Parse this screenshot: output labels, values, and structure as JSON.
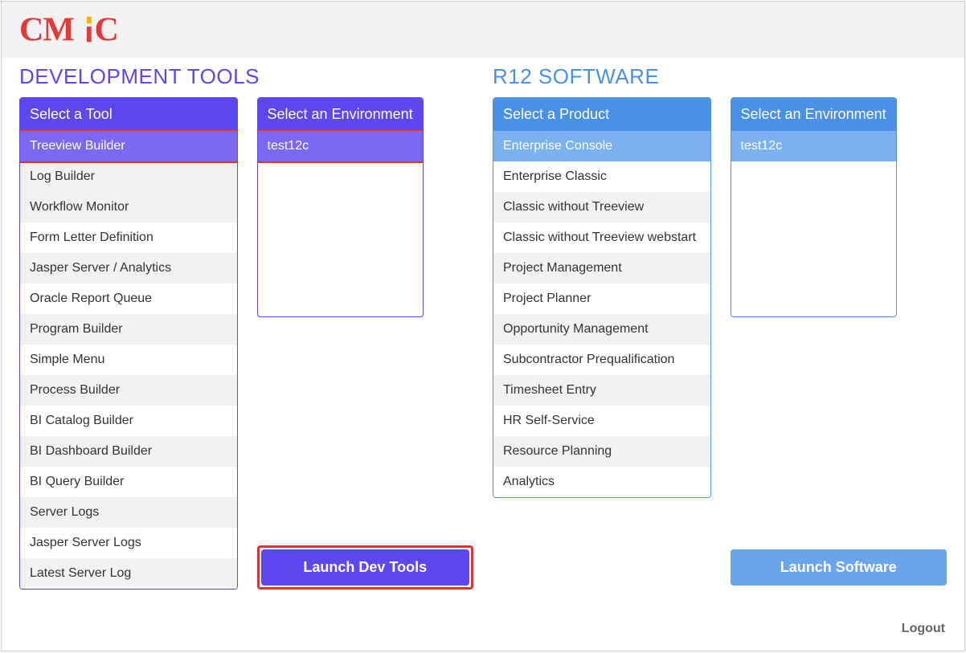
{
  "logo_text": "CMiC",
  "dev": {
    "title": "DEVELOPMENT TOOLS",
    "tool_header": "Select a Tool",
    "tools": [
      "Treeview Builder",
      "Log Builder",
      "Workflow Monitor",
      "Form Letter Definition",
      "Jasper Server / Analytics",
      "Oracle Report Queue",
      "Program Builder",
      "Simple Menu",
      "Process Builder",
      "BI Catalog Builder",
      "BI Dashboard Builder",
      "BI Query Builder",
      "Server Logs",
      "Jasper Server Logs",
      "Latest Server Log"
    ],
    "env_header": "Select an Environment",
    "envs": [
      "test12c"
    ],
    "launch_label": "Launch Dev Tools"
  },
  "r12": {
    "title": "R12 SOFTWARE",
    "product_header": "Select a Product",
    "products": [
      "Enterprise Console",
      "Enterprise Classic",
      "Classic without Treeview",
      "Classic without Treeview webstart",
      "Project Management",
      "Project Planner",
      "Opportunity Management",
      "Subcontractor Prequalification",
      "Timesheet Entry",
      "HR Self-Service",
      "Resource Planning",
      "Analytics"
    ],
    "env_header": "Select an Environment",
    "envs": [
      "test12c"
    ],
    "launch_label": "Launch Software"
  },
  "logout_label": "Logout"
}
